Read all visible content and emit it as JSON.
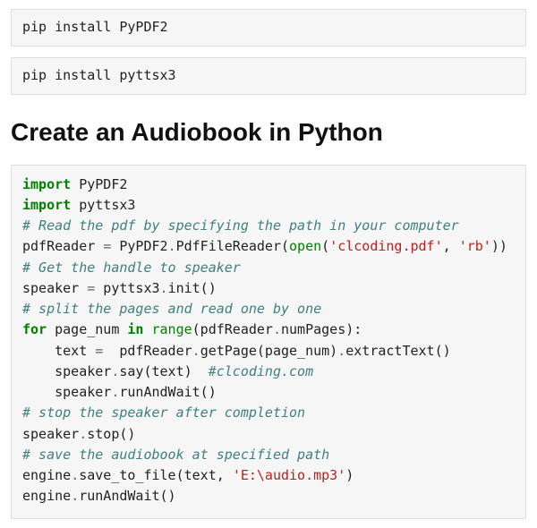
{
  "install1": "pip install PyPDF2",
  "install2": "pip install pyttsx3",
  "heading": "Create an Audiobook in Python",
  "code": {
    "l01_kw": "import",
    "l01_mod": " PyPDF2",
    "l02_kw": "import",
    "l02_mod": " pyttsx3",
    "l03_cm": "# Read the pdf by specifying the path in your computer",
    "l04_a": "pdfReader ",
    "l04_eq": "=",
    "l04_b": " PyPDF2",
    "l04_dot1": ".",
    "l04_c": "PdfFileReader(",
    "l04_open": "open",
    "l04_p1": "(",
    "l04_s1": "'clcoding.pdf'",
    "l04_com": ", ",
    "l04_s2": "'rb'",
    "l04_p2": "))",
    "l05_cm": "# Get the handle to speaker",
    "l06_a": "speaker ",
    "l06_eq": "=",
    "l06_b": " pyttsx3",
    "l06_dot": ".",
    "l06_c": "init()",
    "l07_cm": "# split the pages and read one by one",
    "l08_for": "for",
    "l08_a": " page_num ",
    "l08_in": "in",
    "l08_sp": " ",
    "l08_range": "range",
    "l08_b": "(pdfReader",
    "l08_dot": ".",
    "l08_c": "numPages):",
    "l09_ind": "    text ",
    "l09_eq": "=",
    "l09_b": "  pdfReader",
    "l09_dot1": ".",
    "l09_c": "getPage(page_num)",
    "l09_dot2": ".",
    "l09_d": "extractText()",
    "l10_ind": "    speaker",
    "l10_dot": ".",
    "l10_b": "say(text)  ",
    "l10_cm": "#clcoding.com",
    "l11_ind": "    speaker",
    "l11_dot": ".",
    "l11_b": "runAndWait()",
    "l12_cm": "# stop the speaker after completion",
    "l13_a": "speaker",
    "l13_dot": ".",
    "l13_b": "stop()",
    "l14_cm": "# save the audiobook at specified path",
    "l15_a": "engine",
    "l15_dot": ".",
    "l15_b": "save_to_file(text, ",
    "l15_s": "'E:\\audio.mp3'",
    "l15_c": ")",
    "l16_a": "engine",
    "l16_dot": ".",
    "l16_b": "runAndWait()"
  }
}
